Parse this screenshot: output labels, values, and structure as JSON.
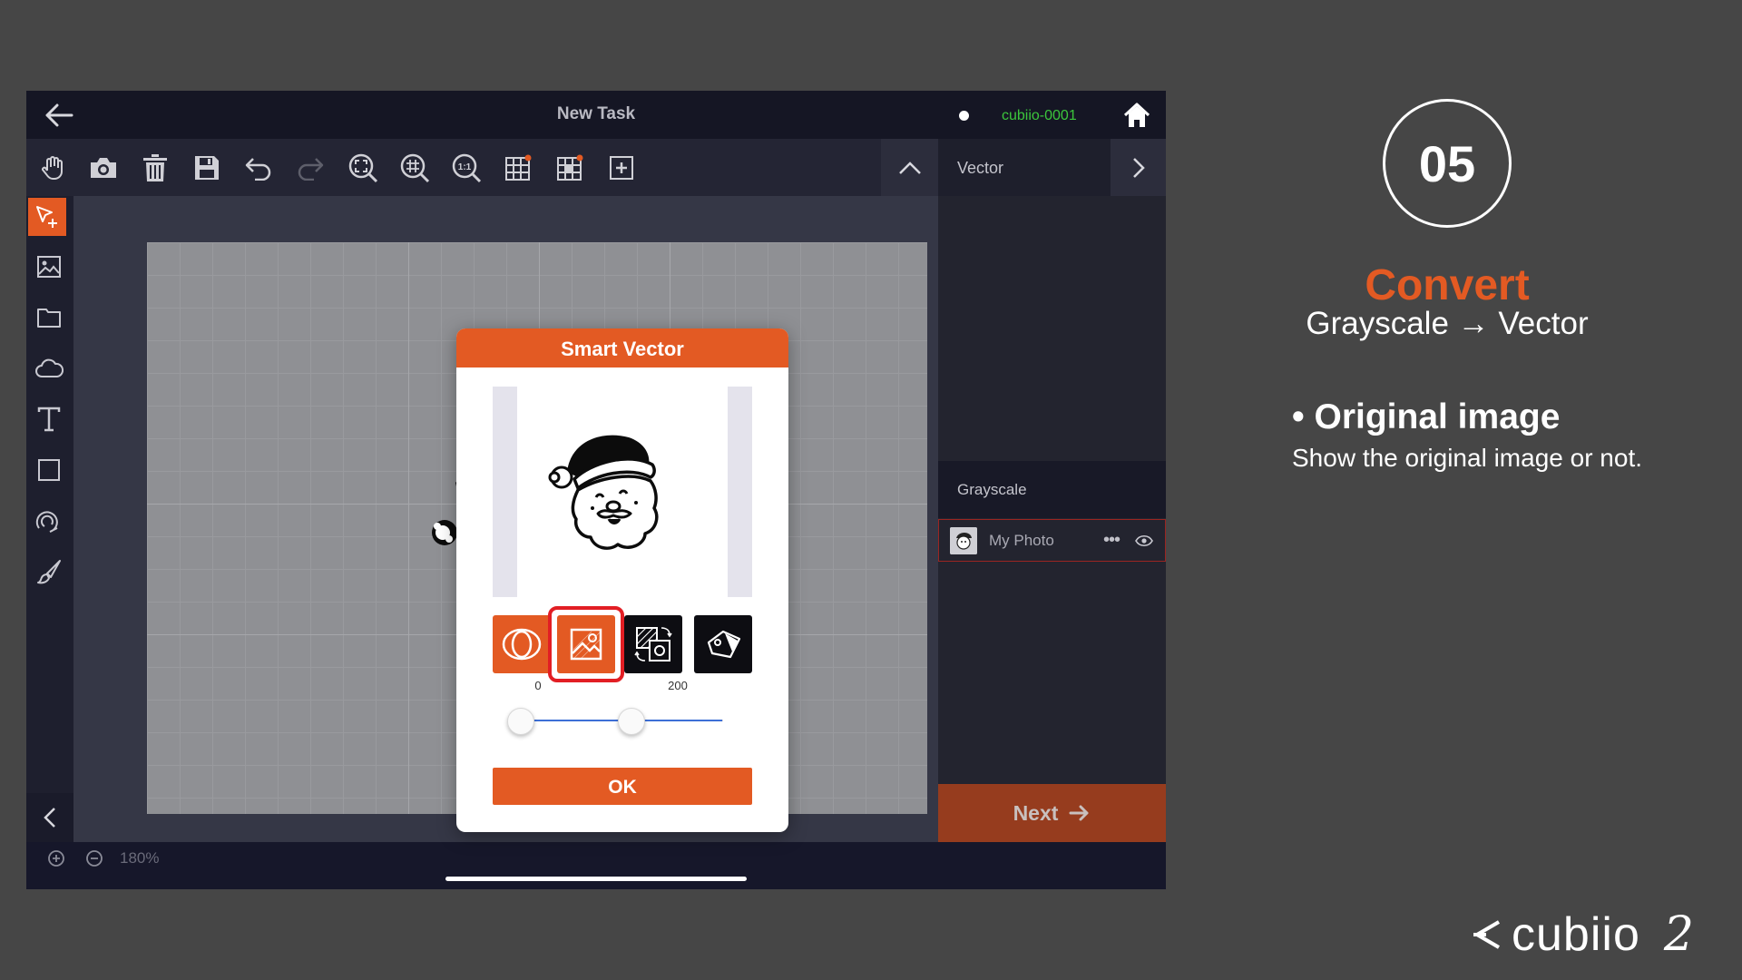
{
  "app": {
    "title": "New Task",
    "device_name": "cubiio-0001",
    "zoom_level": "180%"
  },
  "toolbar": {
    "icons": [
      "hand-icon",
      "camera-icon",
      "trash-icon",
      "save-icon",
      "undo-icon",
      "redo-icon",
      "zoom-fit-icon",
      "zoom-grid-icon",
      "zoom-actual-icon",
      "grid-icon",
      "grid-settings-icon",
      "add-icon"
    ]
  },
  "sidebar": {
    "icons": [
      "select-add-icon",
      "image-icon",
      "folder-icon",
      "cloud-icon",
      "text-icon",
      "rectangle-icon",
      "spiral-icon",
      "brush-icon"
    ]
  },
  "right_panel": {
    "vector_title": "Vector",
    "layers_title": "Grayscale",
    "layer": {
      "name": "My Photo",
      "more": "•••"
    },
    "next_label": "Next"
  },
  "modal": {
    "title": "Smart Vector",
    "options": [
      "outline-mode-icon",
      "original-image-icon",
      "swap-layers-icon",
      "erase-tag-icon"
    ],
    "selected_option": 1,
    "range_low": "0",
    "range_high": "200",
    "slider_low_value": 0,
    "slider_high_value": 200,
    "ok_label": "OK"
  },
  "tutorial": {
    "step": "05",
    "heading": "Convert",
    "subheading": "Grayscale → Vector",
    "bullet_title": "• Original image",
    "bullet_text": "Show the original image or not."
  },
  "brand": {
    "word": "cubiio",
    "number": "2"
  },
  "colors": {
    "accent": "#e35a23",
    "selection_ring": "#e21e24",
    "device_online": "#3cc63c",
    "background": "#464646"
  }
}
